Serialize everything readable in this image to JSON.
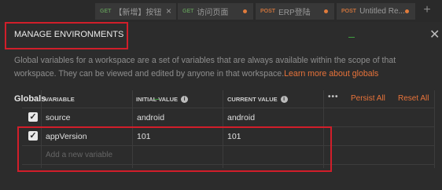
{
  "tabs": [
    {
      "method": "GET",
      "label": "【新增】按钮",
      "state": "close"
    },
    {
      "method": "GET",
      "label": "访问页面",
      "state": "dot"
    },
    {
      "method": "POST",
      "label": "ERP登陆",
      "state": "dot"
    },
    {
      "method": "POST",
      "label": "Untitled Re...",
      "state": "dot"
    }
  ],
  "modal": {
    "title": "MANAGE ENVIRONMENTS",
    "description": "Global variables for a workspace are a set of variables that are always available within the scope of that workspace. They can be viewed and edited by anyone in that workspace.",
    "learn_more": "Learn more about globals",
    "section_title": "Globals"
  },
  "table": {
    "headers": {
      "variable": "VARIABLE",
      "initial_value": "INITIAL VALUE",
      "current_value": "CURRENT VALUE"
    },
    "actions": {
      "more": "•••",
      "persist": "Persist All",
      "reset": "Reset All"
    },
    "rows": [
      {
        "checked": true,
        "variable": "source",
        "initial": "android",
        "current": "android"
      },
      {
        "checked": true,
        "variable": "appVersion",
        "initial": "101",
        "current": "101"
      }
    ],
    "new_placeholder": "Add a new variable"
  },
  "colors": {
    "accent": "#e8733a",
    "highlight": "#d11e2a"
  }
}
